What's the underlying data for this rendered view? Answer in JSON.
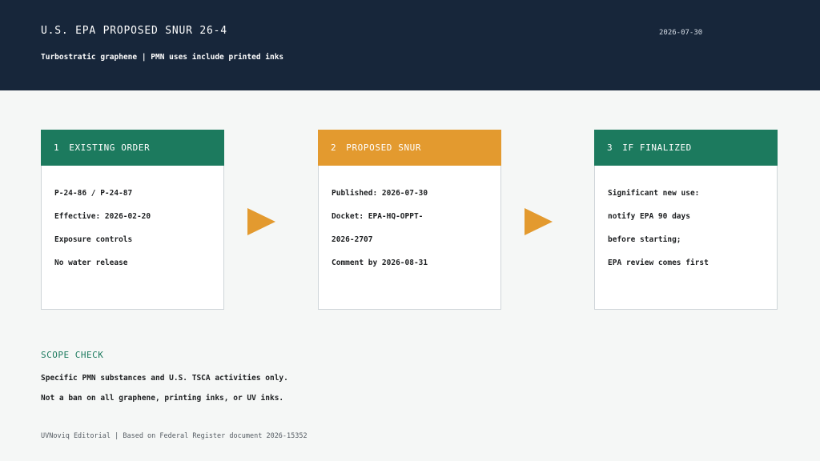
{
  "header": {
    "title": "U.S. EPA PROPOSED SNUR 26-4",
    "date": "2026-07-30",
    "subtitle": "Turbostratic graphene | PMN uses include printed inks"
  },
  "steps": [
    {
      "number": "1",
      "title": "EXISTING ORDER",
      "color": "#1c7a5e",
      "lines": [
        "P-24-86 / P-24-87",
        "Effective: 2026-02-20",
        "Exposure controls",
        "No water release"
      ]
    },
    {
      "number": "2",
      "title": "PROPOSED SNUR",
      "color": "#e39a2f",
      "lines": [
        "Published: 2026-07-30",
        "Docket: EPA-HQ-OPPT-",
        "2026-2707",
        "Comment by 2026-08-31"
      ]
    },
    {
      "number": "3",
      "title": "IF FINALIZED",
      "color": "#1c7a5e",
      "lines": [
        "Significant new use:",
        "notify EPA 90 days",
        "before starting;",
        "EPA review comes first"
      ]
    }
  ],
  "scope": {
    "title": "SCOPE CHECK",
    "lines": [
      "Specific PMN substances and U.S. TSCA activities only.",
      "Not a ban on all graphene, printing inks, or UV inks."
    ]
  },
  "footer": {
    "text": "UVNoviq Editorial | Based on Federal Register document 2026-15352"
  },
  "colors": {
    "header_bg": "#17263a",
    "accent_green": "#1c7a5e",
    "accent_orange": "#e39a2f"
  }
}
